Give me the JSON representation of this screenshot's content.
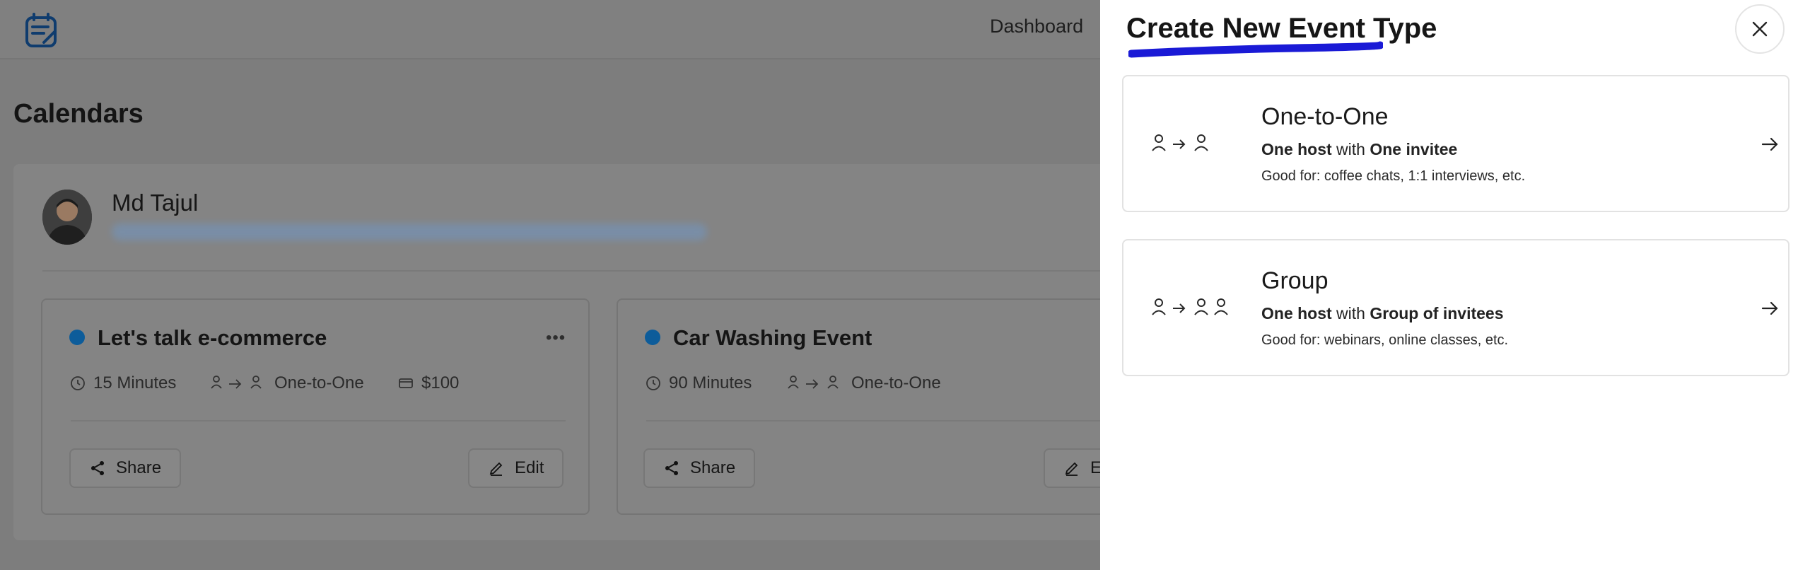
{
  "header": {
    "nav_dashboard": "Dashboard"
  },
  "page": {
    "title": "Calendars"
  },
  "profile": {
    "name": "Md Tajul"
  },
  "event_cards": [
    {
      "title": "Let's talk e-commerce",
      "duration": "15 Minutes",
      "type": "One-to-One",
      "price": "$100",
      "share_label": "Share",
      "edit_label": "Edit",
      "dot_color": "#0d5c9a"
    },
    {
      "title": "Car Washing Event",
      "duration": "90 Minutes",
      "type": "One-to-One",
      "share_label": "Share",
      "edit_label": "E",
      "dot_color": "#0d5c9a"
    }
  ],
  "drawer": {
    "title": "Create New Event Type",
    "underline_color": "#1a1ad6",
    "options": [
      {
        "name": "One-to-One",
        "sub_a": "One host",
        "sub_mid": " with ",
        "sub_b": "One invitee",
        "good_for": "Good for: coffee chats, 1:1 interviews, etc."
      },
      {
        "name": "Group",
        "sub_a": "One host",
        "sub_mid": " with ",
        "sub_b": "Group of invitees",
        "good_for": "Good for: webinars, online classes, etc."
      }
    ]
  },
  "colors": {
    "overlay": "#7d7d7d",
    "drawer_bg": "#ffffff",
    "accent": "#1a1ad6"
  }
}
